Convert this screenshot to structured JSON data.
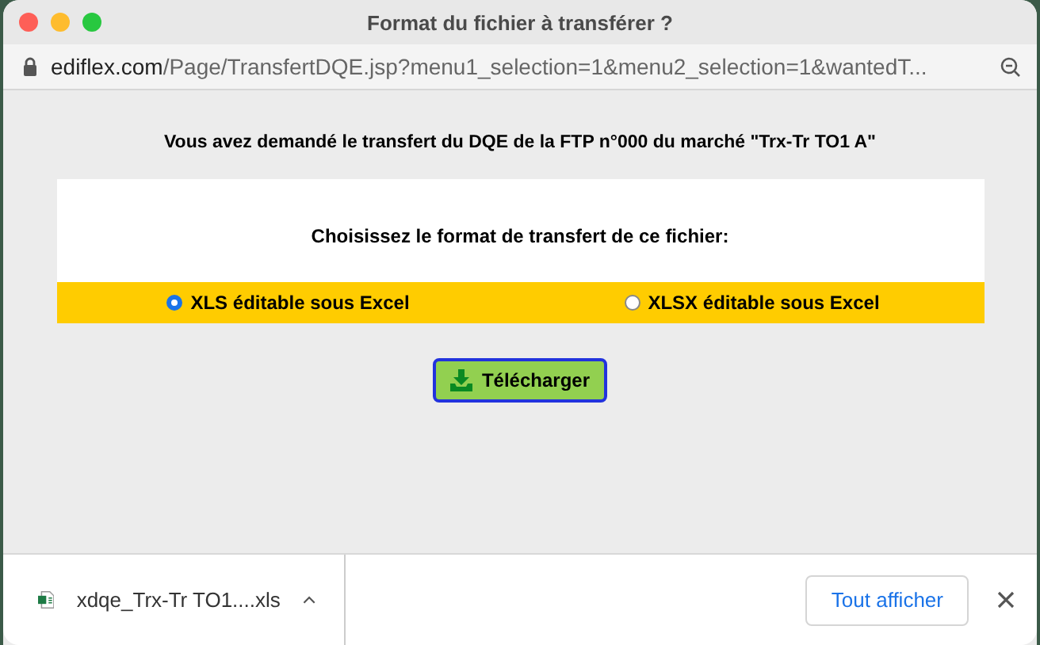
{
  "window": {
    "title": "Format du fichier à transférer ?"
  },
  "address_bar": {
    "domain": "ediflex.com",
    "path": "/Page/TransfertDQE.jsp?menu1_selection=1&menu2_selection=1&wantedT..."
  },
  "heading": "Vous avez demandé le transfert du DQE de la FTP n°000 du marché \"Trx-Tr TO1 A\"",
  "format_panel": {
    "prompt": "Choisissez le format de transfert de ce fichier:",
    "options": [
      {
        "label": "XLS éditable sous Excel",
        "selected": true
      },
      {
        "label": "XLSX éditable sous Excel",
        "selected": false
      }
    ]
  },
  "download_button": "Télécharger",
  "download_bar": {
    "file_name": "xdqe_Trx-Tr TO1....xls",
    "show_all_button": "Tout afficher"
  }
}
